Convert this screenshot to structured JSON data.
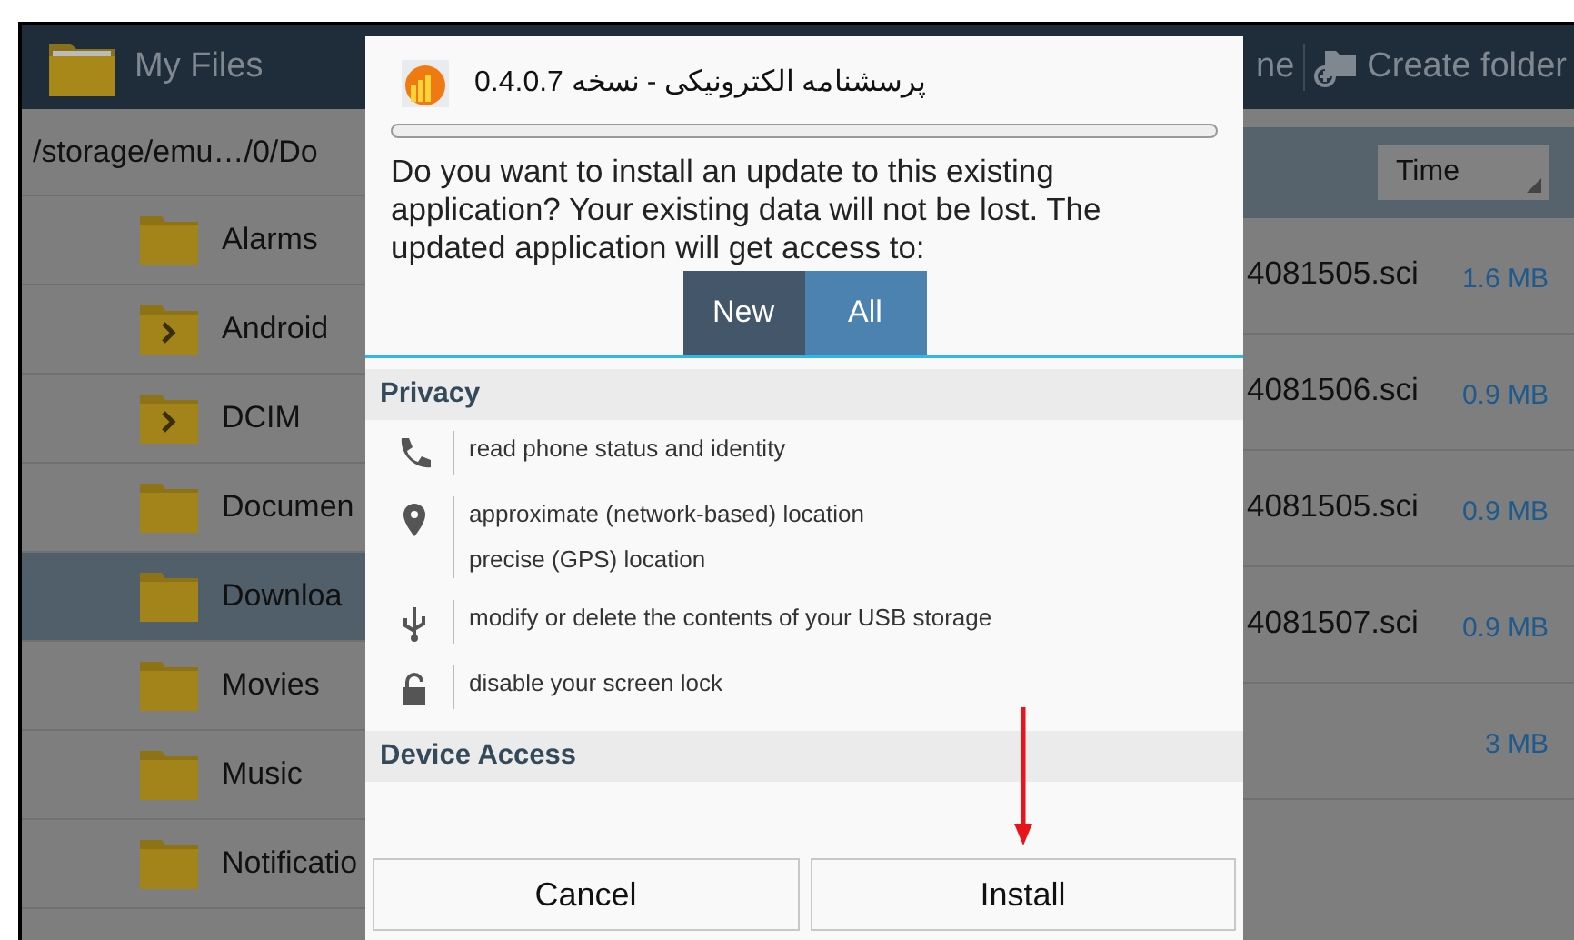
{
  "app_bar": {
    "title": "My Files",
    "cut_action": "ne",
    "create_folder": "Create folder"
  },
  "path": "/storage/emu…/0/Do",
  "sort": {
    "label": "Time"
  },
  "folders": [
    {
      "name": "Alarms",
      "kind": "plain",
      "selected": false
    },
    {
      "name": "Android",
      "kind": "arrow",
      "selected": false
    },
    {
      "name": "DCIM",
      "kind": "arrow",
      "selected": false
    },
    {
      "name": "Documen",
      "kind": "plain",
      "selected": false
    },
    {
      "name": "Downloa",
      "kind": "plain",
      "selected": true
    },
    {
      "name": "Movies",
      "kind": "plain",
      "selected": false
    },
    {
      "name": "Music",
      "kind": "plain",
      "selected": false
    },
    {
      "name": "Notificatio",
      "kind": "plain",
      "selected": false
    }
  ],
  "files": [
    {
      "name": "4081505.sci",
      "size": "1.6 MB"
    },
    {
      "name": "4081506.sci",
      "size": "0.9 MB"
    },
    {
      "name": "4081505.sci",
      "size": "0.9 MB"
    },
    {
      "name": "4081507.sci",
      "size": "0.9 MB"
    },
    {
      "size": "3 MB"
    }
  ],
  "dialog": {
    "title": "پرسشنامه الکترونیکی - نسخه 0.4.0.7",
    "message": "Do you want to install an update to this existing application? Your existing data will not be lost. The updated application will get access to:",
    "tabs": [
      {
        "label": "New",
        "selected": false
      },
      {
        "label": "All",
        "selected": true
      }
    ],
    "sections": [
      {
        "title": "Privacy",
        "permissions": [
          {
            "kind": "phone",
            "lines": [
              "read phone status and identity"
            ]
          },
          {
            "kind": "location",
            "lines": [
              "approximate (network-based) location",
              "precise (GPS) location"
            ]
          },
          {
            "kind": "usb",
            "lines": [
              "modify or delete the contents of your USB storage"
            ]
          },
          {
            "kind": "lock",
            "lines": [
              "disable your screen lock"
            ]
          }
        ]
      },
      {
        "title": "Device Access"
      }
    ],
    "buttons": [
      "Cancel",
      "Install"
    ]
  }
}
